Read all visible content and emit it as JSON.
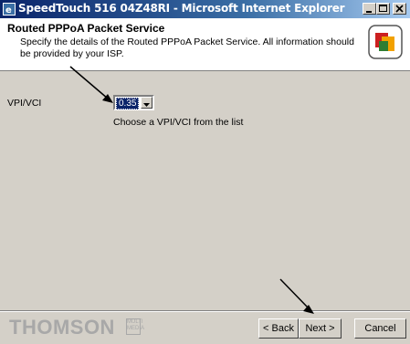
{
  "window": {
    "title": "SpeedTouch 516   04Z48RI - Microsoft Internet Explorer",
    "controls": [
      "minimize",
      "maximize",
      "close"
    ]
  },
  "header": {
    "title": "Routed PPPoA Packet Service",
    "description": "Specify the details of the Routed PPPoA Packet Service. All information should be provided by your ISP."
  },
  "form": {
    "vpi_label": "VPI/VCI",
    "vpi_value": "0.35",
    "hint": "Choose a VPI/VCI from the list"
  },
  "footer": {
    "brand": "THOMSON",
    "brand_sub": "MULTI MEDIA",
    "back_label": "< Back",
    "next_label": "Next >",
    "cancel_label": "Cancel"
  },
  "colors": {
    "titlebar": "#0a246a",
    "dialog_bg": "#d4d0c8",
    "selection": "#0a246a"
  },
  "icons": [
    "ie-icon",
    "minimize-icon",
    "maximize-icon",
    "close-icon",
    "thomson-logo-icon",
    "dropdown-arrow-icon",
    "pointer-arrow-icon"
  ]
}
